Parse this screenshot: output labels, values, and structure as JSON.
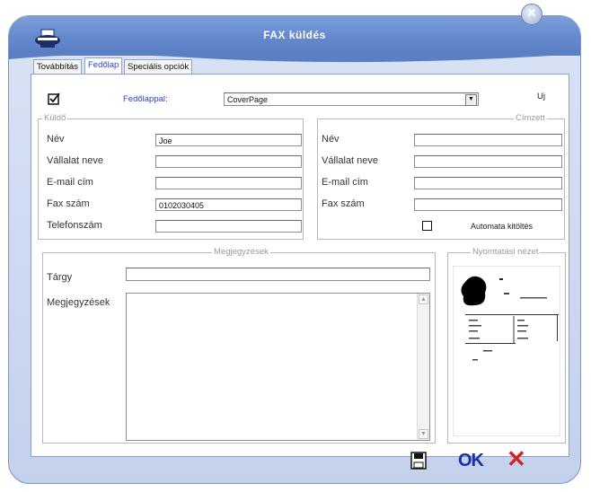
{
  "window": {
    "title": "FAX küldés",
    "close_symbol": "✕"
  },
  "tabs": [
    {
      "label": "Továbbítás",
      "active": false
    },
    {
      "label": "Fedőlap",
      "active": true
    },
    {
      "label": "Speciális opciók",
      "active": false
    }
  ],
  "cover": {
    "checked": true,
    "label": "Fedőlappal:",
    "selected": "CoverPage",
    "new_label": "Uj"
  },
  "sender": {
    "legend": "Küldő",
    "fields": [
      {
        "label": "Név",
        "value": "Joe"
      },
      {
        "label": "Vállalat neve",
        "value": ""
      },
      {
        "label": "E-mail cím",
        "value": ""
      },
      {
        "label": "Fax szám",
        "value": "0102030405"
      },
      {
        "label": "Telefonszám",
        "value": ""
      }
    ]
  },
  "recipient": {
    "legend": "Címzett",
    "fields": [
      {
        "label": "Név",
        "value": ""
      },
      {
        "label": "Vállalat neve",
        "value": ""
      },
      {
        "label": "E-mail cím",
        "value": ""
      },
      {
        "label": "Fax szám",
        "value": ""
      }
    ],
    "autofill_label": "Automata kitöltés",
    "autofill_checked": false
  },
  "notes": {
    "legend": "Megjegyzések",
    "subject_label": "Tárgy",
    "subject_value": "",
    "notes_label": "Megjegyzések",
    "notes_value": ""
  },
  "preview": {
    "legend": "Nyomtatási nézet"
  },
  "footer": {
    "save_icon": "floppy-disk-icon",
    "ok_label": "OK",
    "cancel_symbol": "✕",
    "ok_color": "#1a2fa8",
    "cancel_color": "#d2222a"
  },
  "colors": {
    "title_bar": "#6488cc",
    "window_bg": "#c9d6ee",
    "accent_link": "#2a45b8"
  }
}
